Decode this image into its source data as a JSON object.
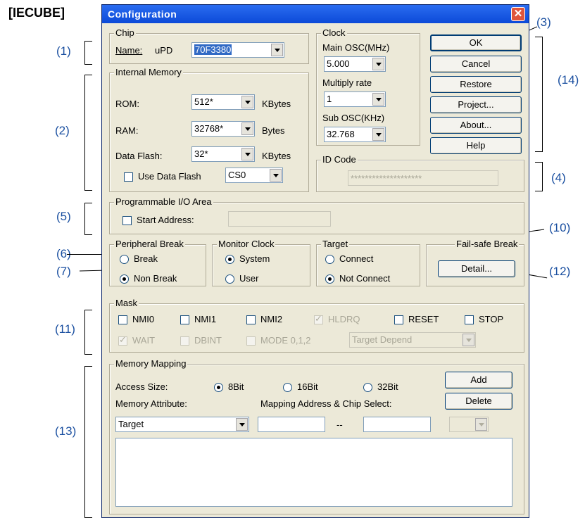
{
  "product_tag": "[IECUBE]",
  "window": {
    "title": "Configuration",
    "close_glyph": "✕"
  },
  "callouts": [
    "(1)",
    "(2)",
    "(3)",
    "(4)",
    "(5)",
    "(6)",
    "(7)",
    "(10)",
    "(11)",
    "(12)",
    "(13)",
    "(14)"
  ],
  "chip": {
    "legend": "Chip",
    "name_label": "Name:",
    "prefix": "uPD",
    "name_value": "70F3380"
  },
  "internal_memory": {
    "legend": "Internal Memory",
    "rom_label": "ROM:",
    "rom_value": "512*",
    "rom_unit": "KBytes",
    "ram_label": "RAM:",
    "ram_value": "32768*",
    "ram_unit": "Bytes",
    "flash_label": "Data Flash:",
    "flash_value": "32*",
    "flash_unit": "KBytes",
    "use_flash_label": "Use Data Flash",
    "cs_value": "CS0"
  },
  "clock": {
    "legend": "Clock",
    "main_osc_label": "Main OSC(MHz)",
    "main_osc_value": "5.000",
    "multiply_label": "Multiply rate",
    "multiply_value": "1",
    "sub_osc_label": "Sub OSC(KHz)",
    "sub_osc_value": "32.768"
  },
  "buttons": {
    "ok": "OK",
    "cancel": "Cancel",
    "restore": "Restore",
    "project": "Project...",
    "about": "About...",
    "help": "Help",
    "detail": "Detail...",
    "add": "Add",
    "delete": "Delete"
  },
  "id_code": {
    "legend": "ID Code",
    "value": "********************"
  },
  "pio": {
    "legend": "Programmable I/O Area",
    "start_label": "Start Address:"
  },
  "peripheral_break": {
    "legend": "Peripheral Break",
    "break_label": "Break",
    "non_break_label": "Non Break"
  },
  "monitor_clock": {
    "legend": "Monitor Clock",
    "system_label": "System",
    "user_label": "User"
  },
  "target": {
    "legend": "Target",
    "connect_label": "Connect",
    "not_connect_label": "Not Connect"
  },
  "failsafe": {
    "legend": "Fail-safe Break"
  },
  "mask": {
    "legend": "Mask",
    "row1": [
      "NMI0",
      "NMI1",
      "NMI2",
      "HLDRQ",
      "RESET",
      "STOP"
    ],
    "row2": [
      "WAIT",
      "DBINT",
      "MODE 0,1,2"
    ],
    "target_depend": "Target Depend"
  },
  "memory_mapping": {
    "legend": "Memory Mapping",
    "access_size_label": "Access Size:",
    "opt8": "8Bit",
    "opt16": "16Bit",
    "opt32": "32Bit",
    "attr_label": "Memory Attribute:",
    "mapping_label": "Mapping Address & Chip Select:",
    "attr_value": "Target",
    "dash": "--"
  }
}
